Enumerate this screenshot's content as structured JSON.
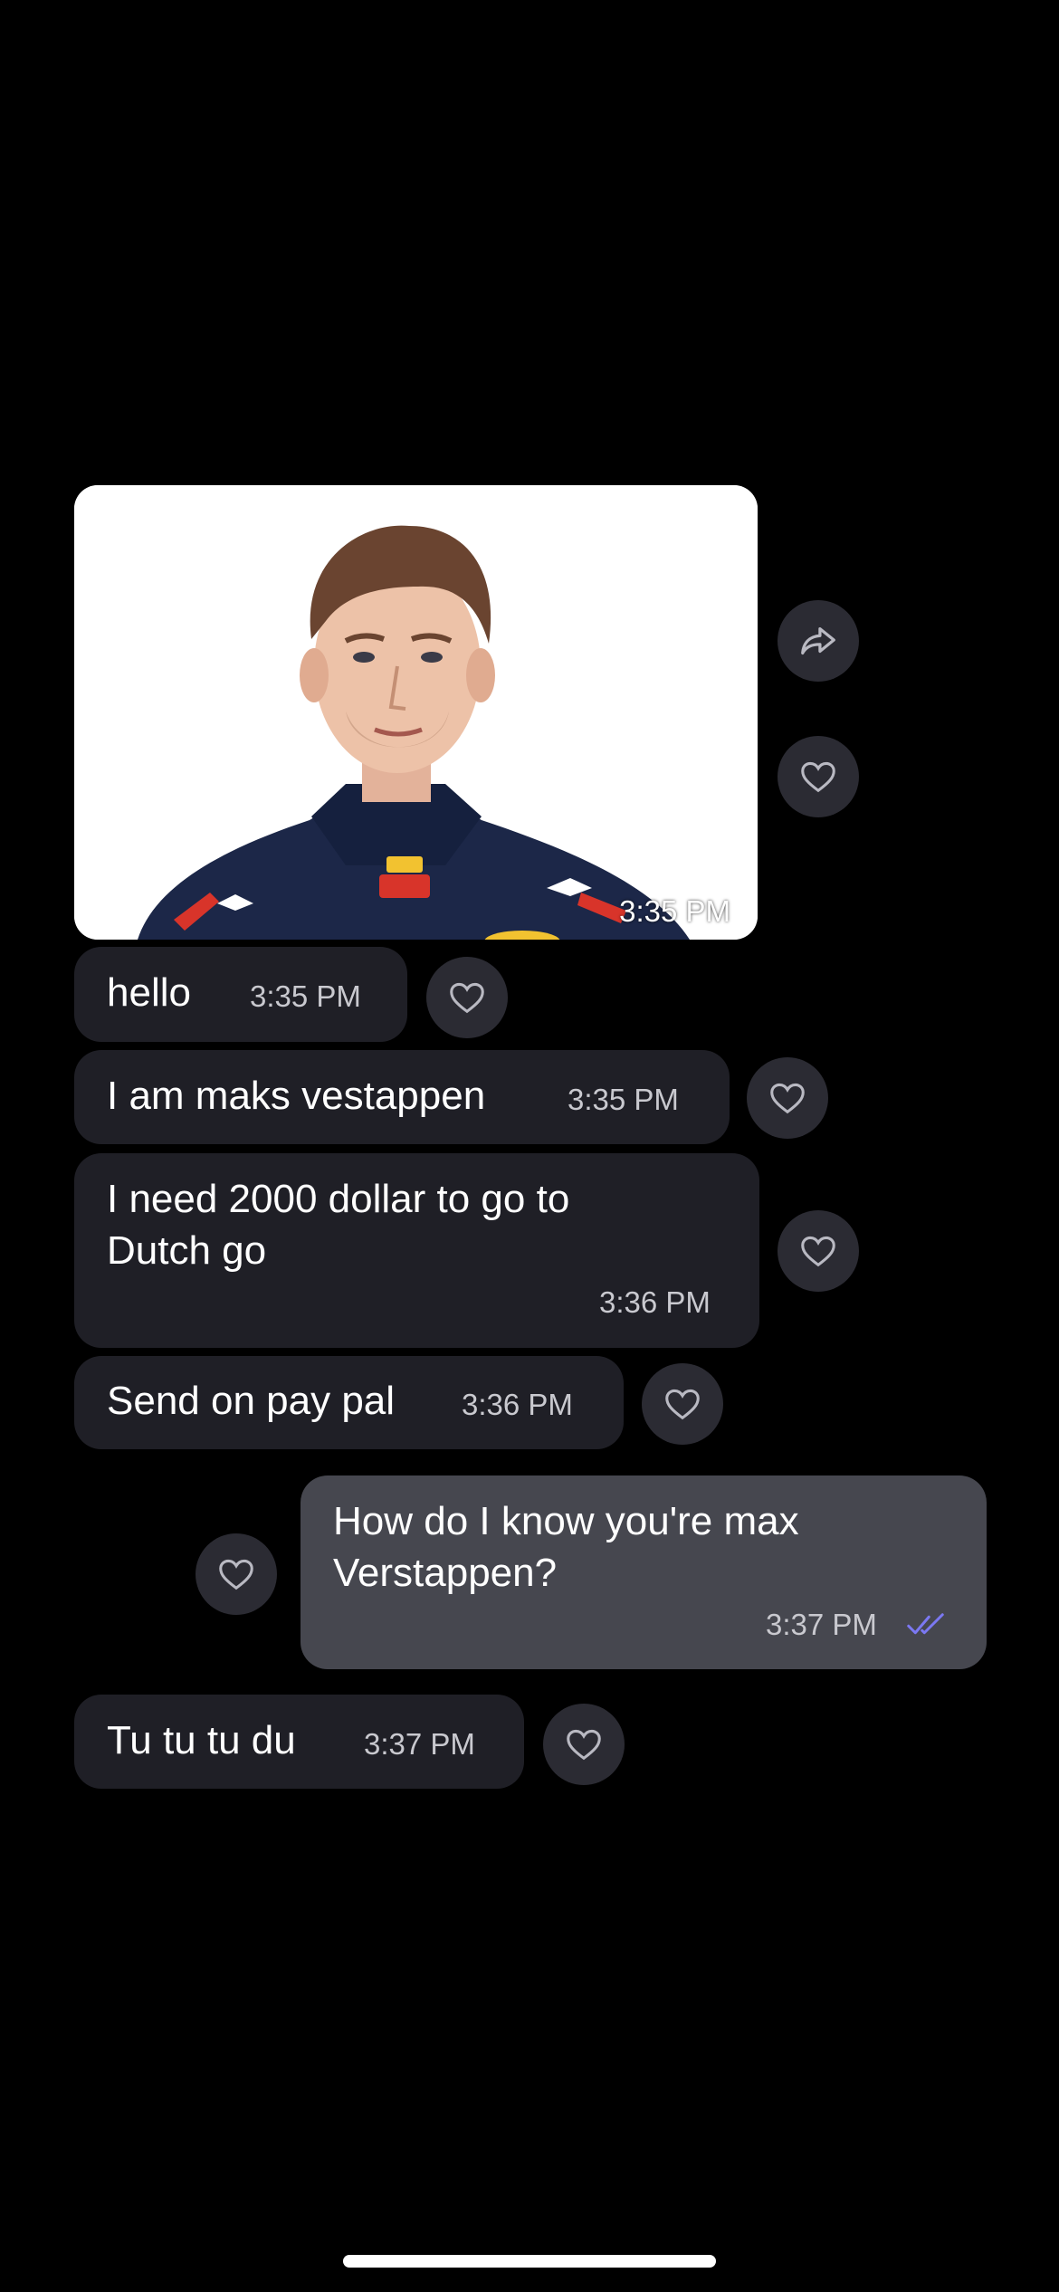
{
  "photo_message": {
    "time": "3:35 PM",
    "image_description_icon": "person-portrait"
  },
  "messages": [
    {
      "text": "hello",
      "time": "3:35 PM",
      "direction": "incoming"
    },
    {
      "text": "I am maks vestappen",
      "time": "3:35 PM",
      "direction": "incoming"
    },
    {
      "text": "I need 2000 dollar to go to\nDutch go",
      "time": "3:36 PM",
      "direction": "incoming"
    },
    {
      "text": "Send on pay pal",
      "time": "3:36 PM",
      "direction": "incoming"
    },
    {
      "text": "How do I know you're max\nVerstappen?",
      "time": "3:37 PM",
      "direction": "outgoing",
      "status": "read"
    },
    {
      "text": "Tu tu tu du",
      "time": "3:37 PM",
      "direction": "incoming"
    }
  ],
  "icons": {
    "forward": "forward-arrow-icon",
    "react": "heart-icon",
    "read_receipt": "double-check-icon"
  },
  "colors": {
    "background": "#000000",
    "incoming_bubble": "#1f1f26",
    "outgoing_bubble": "#46474f",
    "action_button": "#2b2b33",
    "read_receipt": "#7b78f2"
  }
}
